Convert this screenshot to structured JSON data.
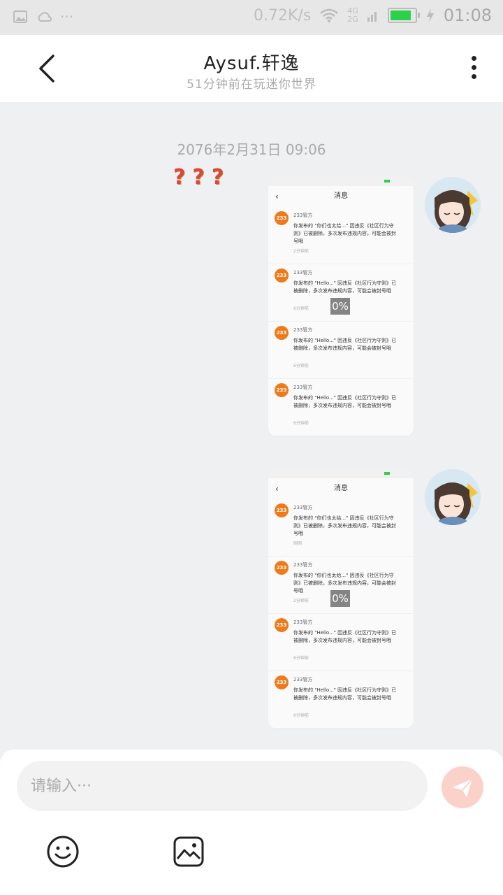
{
  "status_bar": {
    "speed": "0.72K/s",
    "network": [
      "4G",
      "2G"
    ],
    "time": "01:08",
    "battery_level": 0.9
  },
  "header": {
    "title": "Aysuf.轩逸",
    "subtitle": "51分钟前在玩迷你世界",
    "back_icon": "chevron-left-icon",
    "more_icon": "more-vertical-icon"
  },
  "chat": {
    "timestamp": "2076年2月31日 09:06",
    "reaction": [
      "?",
      "?",
      "?"
    ],
    "messages": [
      {
        "nav_title": "消息",
        "progress": "0%",
        "items": [
          {
            "badge": "233",
            "name": "233管方",
            "text": "你发布的 \"你们也太给...\" 因违反《社区行为守则》已被删除，多次发布违规内容，可能会被封号哦",
            "time": "2分钟前"
          },
          {
            "badge": "233",
            "name": "233管方",
            "text": "你发布的 \"Hello...\" 因违反《社区行为守则》已被删除，多次发布违规内容，可能会被封号哦",
            "time": "6分钟前"
          },
          {
            "badge": "233",
            "name": "233管方",
            "text": "你发布的 \"Hello...\" 因违反《社区行为守则》已被删除，多次发布违规内容，可能会被封号哦",
            "time": "6分钟前"
          },
          {
            "badge": "233",
            "name": "233管方",
            "text": "你发布的 \"Hello...\" 因违反《社区行为守则》已被删除，多次发布违规内容，可能会被封号哦",
            "time": "6分钟前"
          }
        ]
      },
      {
        "nav_title": "消息",
        "progress": "0%",
        "items": [
          {
            "badge": "233",
            "name": "233管方",
            "text": "你发布的 \"你们也太给...\" 因违反《社区行为守则》已被删除，多次发布违规内容，可能会被封号哦",
            "time": "刚刚"
          },
          {
            "badge": "233",
            "name": "233管方",
            "text": "你发布的 \"你们也太给...\" 因违反《社区行为守则》已被删除，多次发布违规内容，可能会被封号哦",
            "time": "2分钟前"
          },
          {
            "badge": "233",
            "name": "233管方",
            "text": "你发布的 \"Hello...\" 因违反《社区行为守则》已被删除，多次发布违规内容，可能会被封号哦",
            "time": "6分钟前"
          },
          {
            "badge": "233",
            "name": "233管方",
            "text": "你发布的 \"Hello...\" 因违反《社区行为守则》已被删除，多次发布违规内容，可能会被封号哦",
            "time": "6分钟前"
          }
        ]
      }
    ]
  },
  "input_bar": {
    "placeholder": "请输入···",
    "send_icon": "send-icon",
    "emoji_icon": "emoji-icon",
    "image_icon": "image-icon"
  },
  "colors": {
    "accent_send": "#fbd2c9",
    "badge": "#f07a1a",
    "battery": "#2bd14a"
  }
}
